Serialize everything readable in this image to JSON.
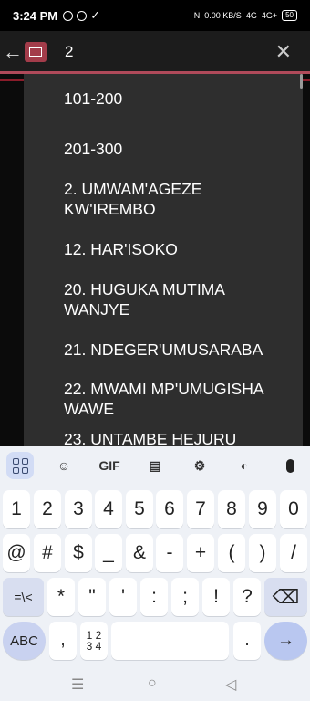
{
  "status_bar": {
    "time": "3:24 PM",
    "speed": "0.00 KB/S",
    "network": "4G",
    "network2": "4G+",
    "battery": "50"
  },
  "search": {
    "query": "2",
    "back_icon": "arrow-left-icon",
    "clear_icon": "close-icon",
    "app_icon": "app-logo-icon"
  },
  "suggestions": [
    "101-200",
    "201-300",
    "2. UMWAM'AGEZE KW'IREMBO",
    "12. HAR'ISOKO",
    "20. HUGUKA MUTIMA WANJYE",
    "21. NDEGER'UMUSARABA",
    "22. MWAMI MP'UMUGISHA WAWE",
    "23. UNTAMBE HEJURU"
  ],
  "keyboard": {
    "toolbar": {
      "gif": "GIF"
    },
    "row1": [
      "1",
      "2",
      "3",
      "4",
      "5",
      "6",
      "7",
      "8",
      "9",
      "0"
    ],
    "row2": [
      "@",
      "#",
      "$",
      "_",
      "&",
      "-",
      "+",
      "(",
      ")",
      "/"
    ],
    "row3": [
      "=\\<",
      "*",
      "\"",
      "'",
      ":",
      ";",
      "!",
      "?"
    ],
    "row4": {
      "abc": "ABC",
      "comma": ",",
      "numlet_top": "1 2",
      "numlet_bottom": "3 4",
      "period": ".",
      "enter": "→"
    }
  },
  "nav": {
    "recents": "☰",
    "home": "○",
    "back": "◁"
  },
  "colors": {
    "accent": "#b04a5a",
    "dropdown_bg": "#2e2e2e",
    "keyboard_bg": "#eef1f6"
  }
}
